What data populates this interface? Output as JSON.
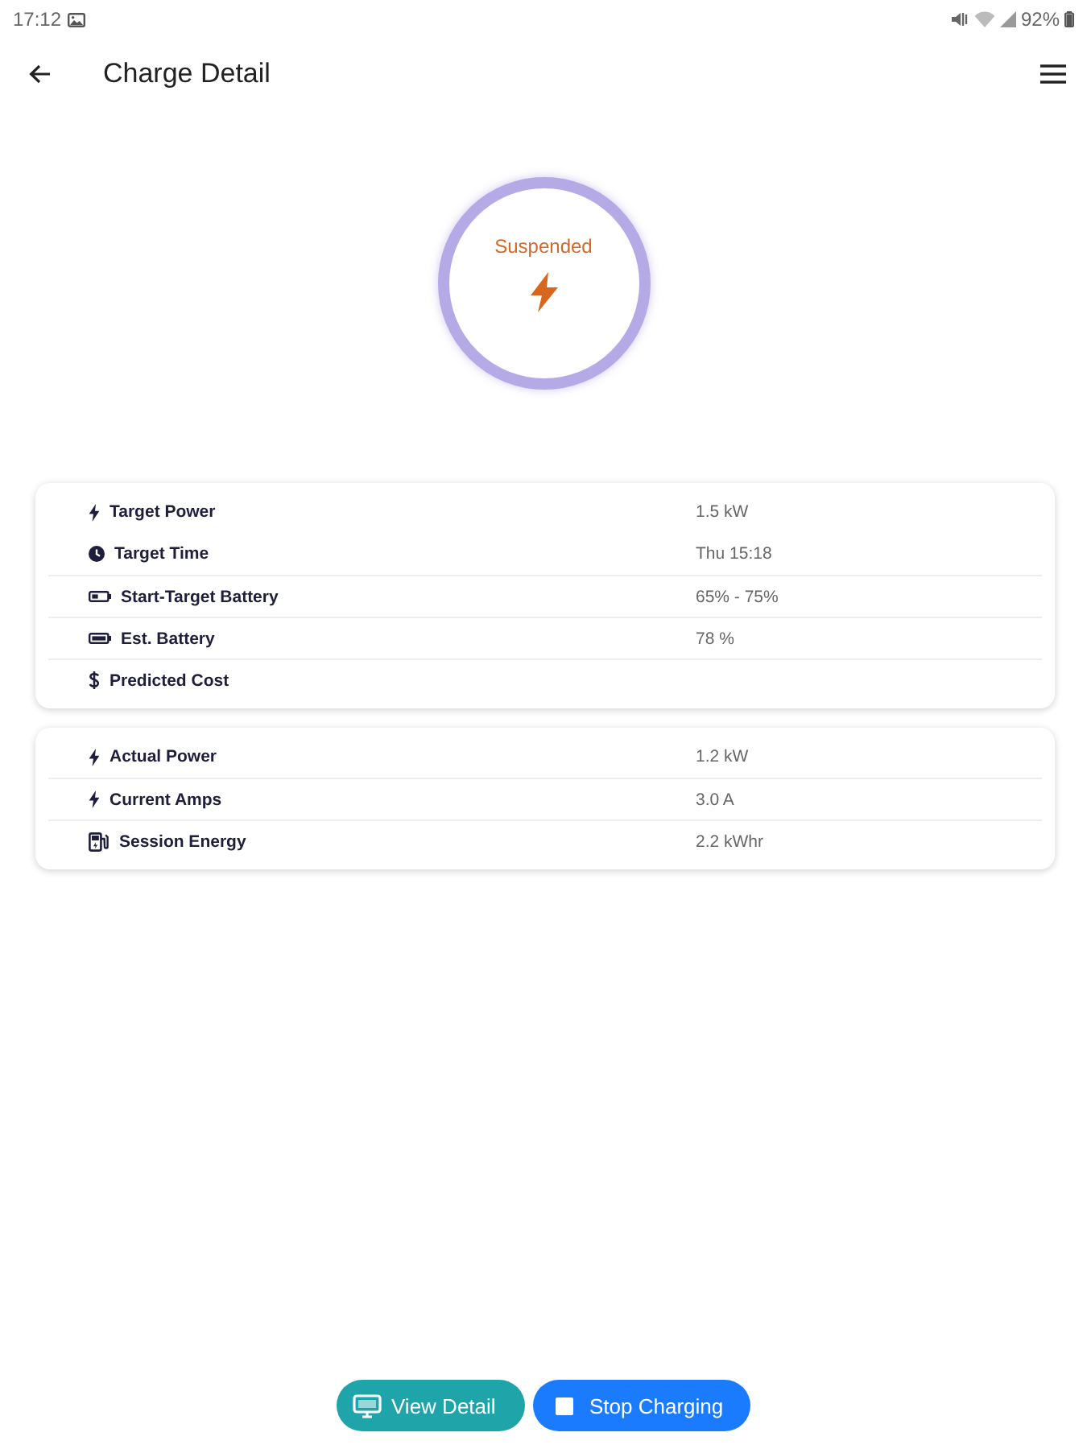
{
  "status_bar": {
    "time": "17:12",
    "battery": "92%"
  },
  "app_bar": {
    "title": "Charge Detail"
  },
  "charge_status": {
    "label": "Suspended"
  },
  "cards": [
    {
      "rows": [
        {
          "kind": "bolt",
          "label": "Target Power",
          "value": "1.5 kW"
        },
        {
          "kind": "clock",
          "label": "Target Time",
          "value": "Thu 15:18"
        },
        {
          "kind": "battery_low",
          "label": "Start-Target Battery",
          "value": "65% - 75%"
        },
        {
          "kind": "battery_full",
          "label": "Est. Battery",
          "value": "78 %"
        },
        {
          "kind": "dollar",
          "label": "Predicted Cost"
        }
      ]
    },
    {
      "rows": [
        {
          "kind": "bolt",
          "label": "Actual Power",
          "value": "1.2 kW"
        },
        {
          "kind": "bolt",
          "label": "Current Amps",
          "value": "3.0 A"
        },
        {
          "kind": "pump",
          "label": "Session Energy",
          "value": "2.2 kWhr"
        }
      ]
    }
  ],
  "buttons": [
    {
      "kind": "secondary",
      "label": "View Detail"
    },
    {
      "kind": "primary",
      "label": "Stop Charging"
    }
  ]
}
